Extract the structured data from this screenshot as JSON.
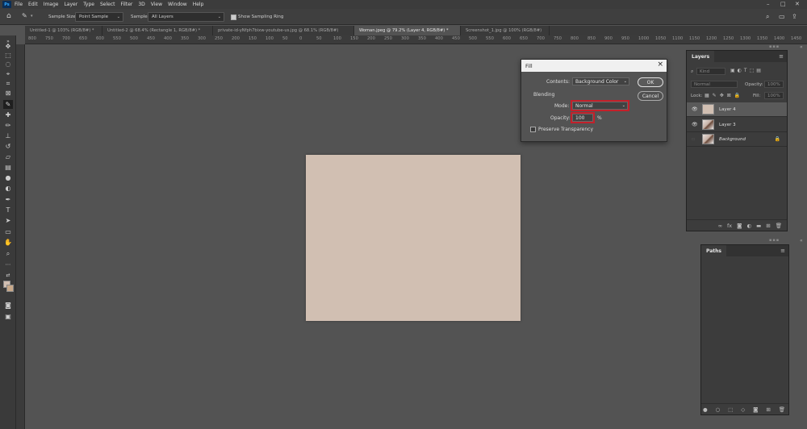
{
  "menubar": {
    "logo": "Ps",
    "items": [
      "File",
      "Edit",
      "Image",
      "Layer",
      "Type",
      "Select",
      "Filter",
      "3D",
      "View",
      "Window",
      "Help"
    ],
    "controls": [
      "–",
      "□",
      "✕"
    ]
  },
  "options_bar": {
    "sample_size_label": "Sample Size:",
    "sample_size_value": "Point Sample",
    "sample_label": "Sample:",
    "sample_value": "All Layers",
    "sampling_ring_label": "Show Sampling Ring",
    "sampling_ring_checked": true
  },
  "tabs": [
    {
      "label": "Untitled-1 @ 103% (RGB/8#) *",
      "active": false
    },
    {
      "label": "Untitled-2 @ 68.4% (Rectangle 1, RGB/8#) *",
      "active": false
    },
    {
      "label": "private-id-yNfph7bixw-youtube-us.jpg @ 68.1% (RGB/8#)",
      "active": false
    },
    {
      "label": "Woman.jpeg @ 79.2% (Layer 4, RGB/8#) *",
      "active": true
    },
    {
      "label": "Screenshot_1.jpg @ 100% (RGB/8#)",
      "active": false
    }
  ],
  "ruler_ticks": [
    "800",
    "750",
    "700",
    "650",
    "600",
    "550",
    "500",
    "450",
    "400",
    "350",
    "300",
    "250",
    "200",
    "150",
    "100",
    "50",
    "0",
    "50",
    "100",
    "150",
    "200",
    "250",
    "300",
    "350",
    "400",
    "450",
    "500",
    "550",
    "600",
    "650",
    "700",
    "750",
    "800",
    "850",
    "900",
    "950",
    "1000",
    "1050",
    "1100",
    "1150",
    "1200",
    "1250",
    "1300",
    "1350",
    "1400",
    "1450"
  ],
  "canvas": {
    "fill_color": "#d1bfb2"
  },
  "fill_dialog": {
    "title": "Fill",
    "contents_label": "Contents:",
    "contents_value": "Background Color",
    "blending_label": "Blending",
    "mode_label": "Mode:",
    "mode_value": "Normal",
    "opacity_label": "Opacity:",
    "opacity_value": "100",
    "opacity_unit": "%",
    "preserve_label": "Preserve Transparency",
    "preserve_checked": false,
    "ok_label": "OK",
    "cancel_label": "Cancel"
  },
  "layers_panel": {
    "tab_label": "Layers",
    "filter_placeholder": "Kind",
    "blend_mode": "Normal",
    "opacity_label": "Opacity:",
    "opacity_value": "100%",
    "lock_label": "Lock:",
    "fill_label": "Fill:",
    "fill_value": "100%",
    "layers": [
      {
        "name": "Layer 4",
        "visible": true,
        "selected": true,
        "thumb": "swatch"
      },
      {
        "name": "Layer 3",
        "visible": true,
        "selected": false,
        "thumb": "photo"
      },
      {
        "name": "Background",
        "visible": false,
        "selected": false,
        "thumb": "photo",
        "locked": true
      }
    ],
    "footer_icons": [
      "link-icon",
      "fx-icon",
      "mask-icon",
      "adjustment-icon",
      "folder-icon",
      "new-layer-icon",
      "trash-icon"
    ]
  },
  "paths_panel": {
    "tab_label": "Paths",
    "footer_icons": [
      "fill-path-icon",
      "stroke-path-icon",
      "selection-icon",
      "work-path-icon",
      "mask-icon",
      "new-path-icon",
      "trash-icon"
    ]
  },
  "accent_colors": {
    "highlight_red": "#c3202a",
    "ps_blue": "#31a8ff"
  }
}
